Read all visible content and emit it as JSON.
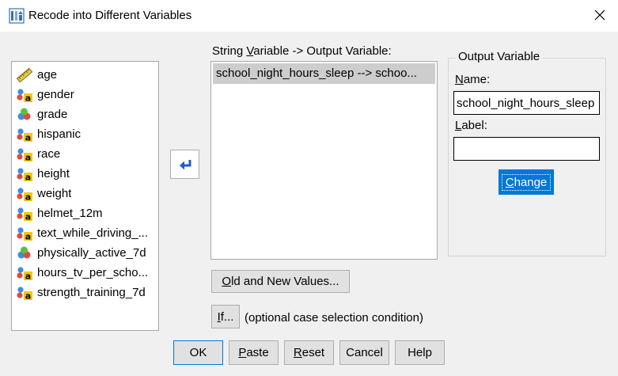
{
  "window": {
    "title": "Recode into Different Variables",
    "icon": "recode-icon",
    "close_icon": "close-icon"
  },
  "variables": [
    {
      "label": "age",
      "icon": "ruler-scale-icon"
    },
    {
      "label": "gender",
      "icon": "nominal-string-icon"
    },
    {
      "label": "grade",
      "icon": "ordinal-icon"
    },
    {
      "label": "hispanic",
      "icon": "nominal-string-icon"
    },
    {
      "label": "race",
      "icon": "nominal-string-icon"
    },
    {
      "label": "height",
      "icon": "nominal-string-icon"
    },
    {
      "label": "weight",
      "icon": "nominal-string-icon"
    },
    {
      "label": "helmet_12m",
      "icon": "nominal-string-icon"
    },
    {
      "label": "text_while_driving_...",
      "icon": "nominal-string-icon"
    },
    {
      "label": "physically_active_7d",
      "icon": "ordinal-icon"
    },
    {
      "label": "hours_tv_per_scho...",
      "icon": "nominal-string-icon"
    },
    {
      "label": "strength_training_7d",
      "icon": "nominal-string-icon"
    }
  ],
  "mapping": {
    "heading_prefix": "String ",
    "heading_underline": "V",
    "heading_suffix": "ariable -> Output Variable:",
    "rows": [
      "school_night_hours_sleep --> schoo..."
    ]
  },
  "output_variable": {
    "group_title": "Output Variable",
    "name_label_u": "N",
    "name_label_rest": "ame:",
    "name_value": "school_night_hours_sleep",
    "label_label_u": "L",
    "label_label_rest": "abel:",
    "label_value": "",
    "change_u": "C",
    "change_rest": "hange"
  },
  "old_new": {
    "u": "O",
    "rest": "ld and New Values..."
  },
  "if_section": {
    "u": "I",
    "rest": "f...",
    "caption": "(optional case selection condition)"
  },
  "buttons": {
    "ok": "OK",
    "paste_u": "P",
    "paste_rest": "aste",
    "reset_u": "R",
    "reset_rest": "eset",
    "cancel": "Cancel",
    "help": "Help"
  },
  "colors": {
    "accent": "#0078d7",
    "selected_row": "#cdcdcd",
    "background": "#f0f0f0"
  }
}
